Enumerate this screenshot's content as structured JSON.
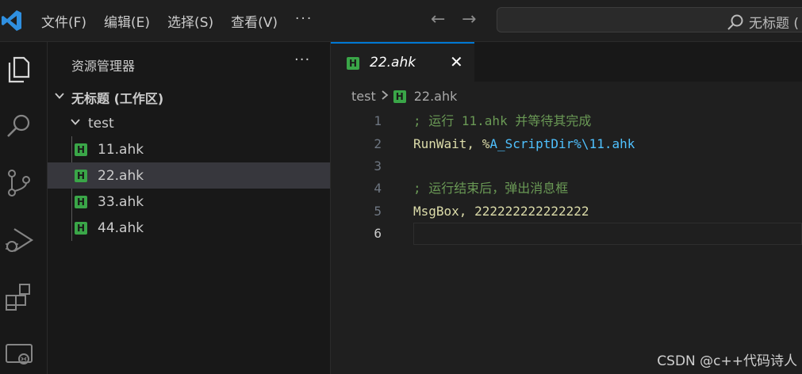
{
  "menu": {
    "file": "文件(F)",
    "edit": "编辑(E)",
    "selection": "选择(S)",
    "view": "查看(V)",
    "more": "···"
  },
  "search": {
    "text": "无标题 ("
  },
  "sidebar": {
    "title": "资源管理器",
    "more": "···",
    "workspace": "无标题 (工作区)",
    "folder": "test",
    "files": [
      "11.ahk",
      "22.ahk",
      "33.ahk",
      "44.ahk"
    ],
    "selected_index": 1
  },
  "tab": {
    "label": "22.ahk",
    "icon_letter": "H"
  },
  "breadcrumb": {
    "folder": "test",
    "file": "22.ahk"
  },
  "editor": {
    "line_numbers": [
      "1",
      "2",
      "3",
      "4",
      "5",
      "6"
    ],
    "lines": {
      "l1": "; 运行 11.ahk 并等待其完成",
      "l2_cmd": "RunWait, %",
      "l2_var": "A_ScriptDir",
      "l2_rest": "%\\11.ahk",
      "l4": "; 运行结束后，弹出消息框",
      "l5": "MsgBox, 222222222222222"
    }
  },
  "watermark": "CSDN @c++代码诗人",
  "colors": {
    "accent": "#0078d4",
    "ahk_icon": "#3aa648",
    "comment": "#6a9955",
    "function": "#dcdcaa",
    "variable": "#4fc1ff"
  }
}
